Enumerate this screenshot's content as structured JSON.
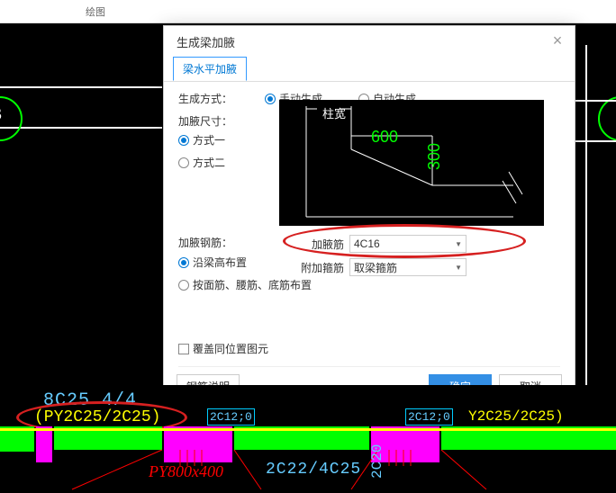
{
  "toolbar": {
    "huitu": "绘图"
  },
  "dialog": {
    "title": "生成梁加腋",
    "tab": "梁水平加腋",
    "gen_method_label": "生成方式：",
    "gen_manual": "手动生成",
    "gen_auto": "自动生成",
    "size_label": "加腋尺寸：",
    "mode1": "方式一",
    "mode2": "方式二",
    "diagram": {
      "zhukuan": "柱宽",
      "d600": "600",
      "d300": "300"
    },
    "rebar_label": "加腋钢筋：",
    "along_height": "沿梁高布置",
    "by_top": "按面筋、腰筋、底筋布置",
    "jiayejin_label": "加腋筋",
    "jiayejin_value": "4C16",
    "fujiaguijin_label": "附加箍筋",
    "fujiaguijin_value": "取梁箍筋",
    "cover_label": "覆盖同位置图元",
    "info_btn": "钢筋说明",
    "ok": "确定",
    "cancel": "取消"
  },
  "cad": {
    "t_8c25": "8C25 4/4",
    "t_py": "(PY2C25/2C25)",
    "t_2c12a": "2C12;0",
    "t_2c12b": "2C12;0",
    "t_y2c25": "Y2C25/2C25)",
    "t_2c22": "2C22/4C25",
    "t_2c20": "2C20",
    "t_py800": "PY800x400"
  }
}
